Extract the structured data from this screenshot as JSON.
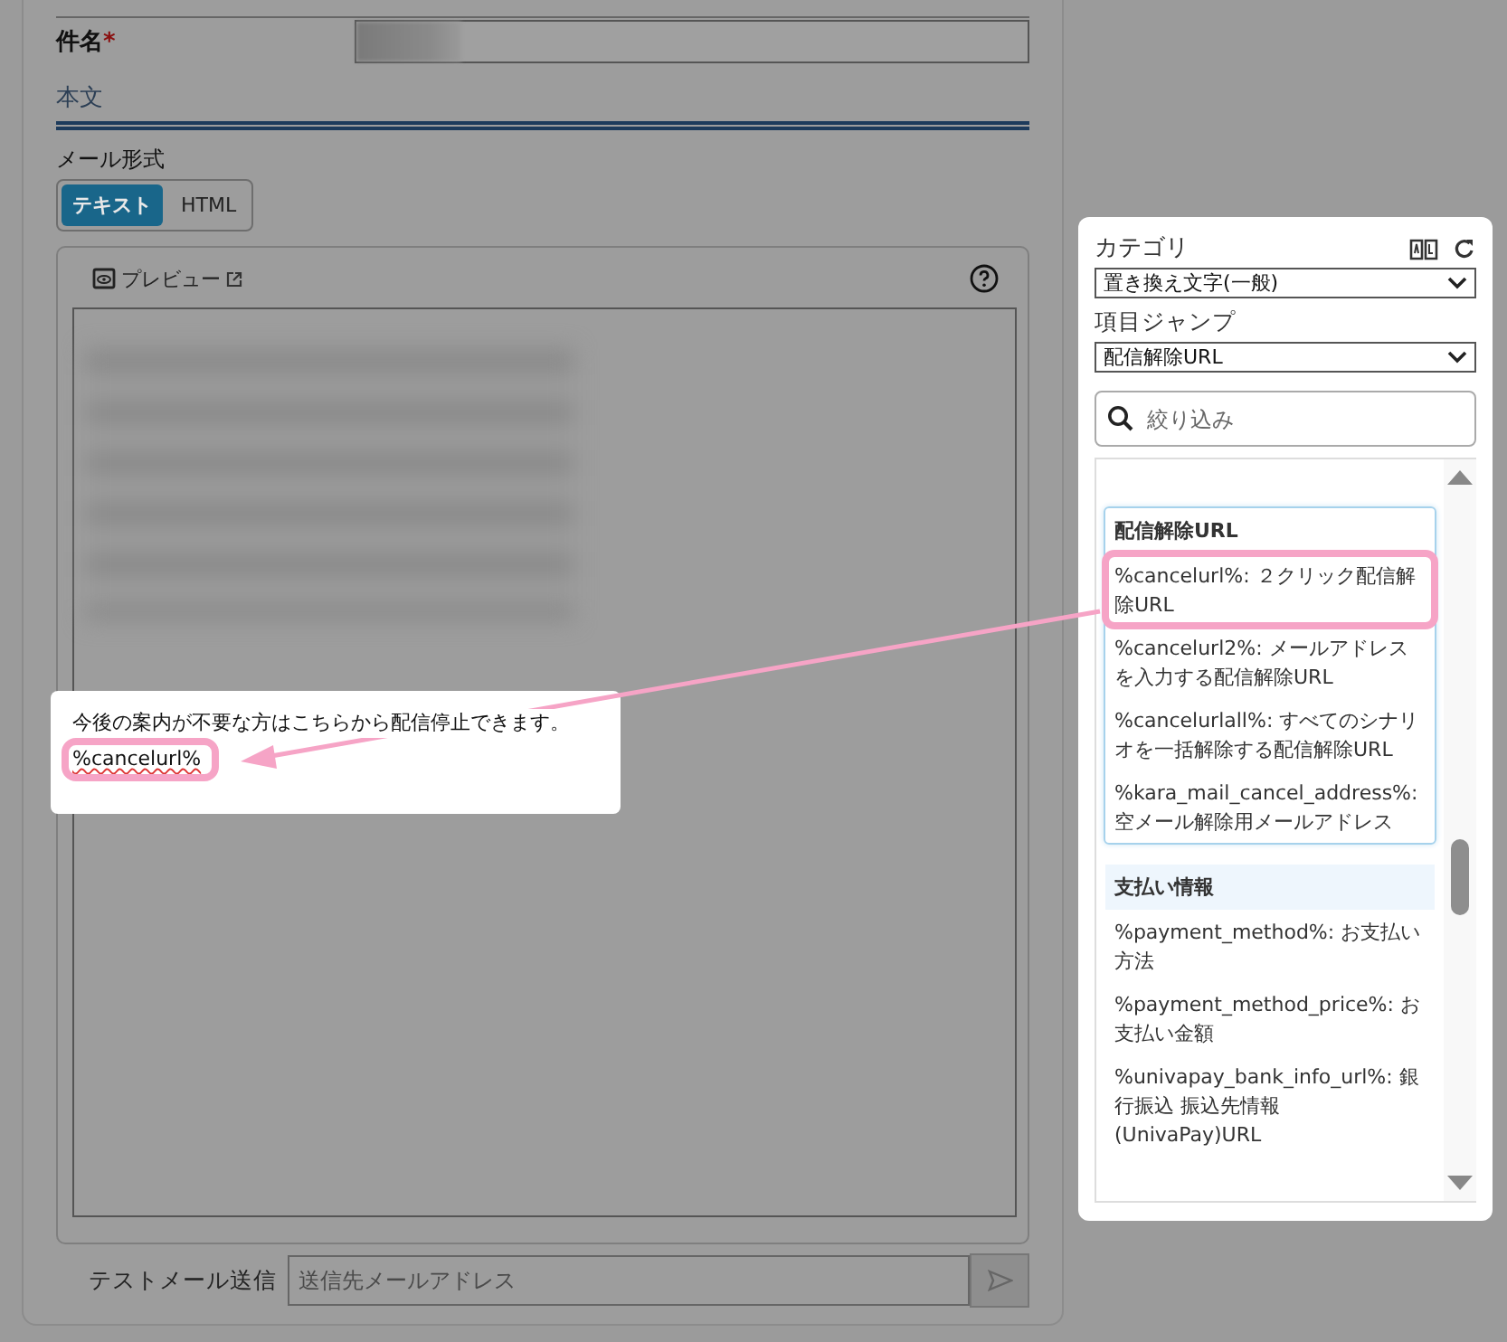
{
  "subject": {
    "label": "件名",
    "required_mark": "*"
  },
  "section_title": "本文",
  "mail_format": {
    "label": "メール形式",
    "options": [
      {
        "label": "テキスト",
        "selected": true
      },
      {
        "label": "HTML",
        "selected": false
      }
    ]
  },
  "editor": {
    "preview_label": "プレビュー",
    "callout_lines": [
      {
        "text": "今後の案内が不要な方はこちらから配信停止できます。",
        "highlighted": false
      },
      {
        "text": "%cancelurl%",
        "highlighted": true
      }
    ]
  },
  "test_send": {
    "label": "テストメール送信",
    "placeholder": "送信先メールアドレス"
  },
  "side_panel": {
    "category_label": "カテゴリ",
    "category_value": "置き換え文字(一般)",
    "jump_label": "項目ジャンプ",
    "jump_value": "配信解除URL",
    "search_placeholder": "絞り込み",
    "groups": [
      {
        "title": "配信解除URL",
        "selected": true,
        "items": [
          {
            "text": "%cancelurl%: ２クリック配信解除URL",
            "highlighted": true
          },
          {
            "text": "%cancelurl2%: メールアドレスを入力する配信解除URL",
            "highlighted": false
          },
          {
            "text": "%cancelurlall%: すべてのシナリオを一括解除する配信解除URL",
            "highlighted": false
          },
          {
            "text": "%kara_mail_cancel_address%: 空メール解除用メールアドレス",
            "highlighted": false
          }
        ]
      },
      {
        "title": "支払い情報",
        "selected": false,
        "items": [
          {
            "text": "%payment_method%: お支払い方法",
            "highlighted": false
          },
          {
            "text": "%payment_method_price%: お支払い金額",
            "highlighted": false
          },
          {
            "text": "%univapay_bank_info_url%: 銀行振込 振込先情報(UnivaPay)URL",
            "highlighted": false
          }
        ]
      }
    ]
  }
}
